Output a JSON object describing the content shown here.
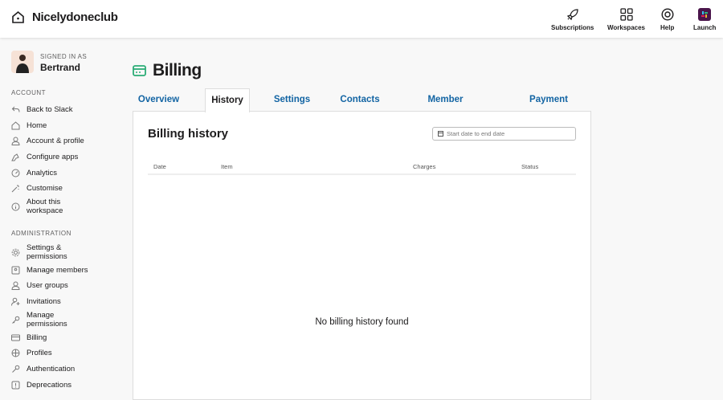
{
  "header": {
    "workspace_name": "Nicelydoneclub",
    "nav": [
      {
        "label": "Subscriptions",
        "icon": "rocket-icon"
      },
      {
        "label": "Workspaces",
        "icon": "grid-icon"
      },
      {
        "label": "Help",
        "icon": "lifebuoy-icon"
      },
      {
        "label": "Launch",
        "icon": "slack-icon"
      }
    ]
  },
  "user": {
    "signed_in_label": "SIGNED IN AS",
    "name": "Bertrand"
  },
  "sidebar": {
    "account_heading": "ACCOUNT",
    "account_items": [
      {
        "label": "Back to Slack"
      },
      {
        "label": "Home"
      },
      {
        "label": "Account & profile"
      },
      {
        "label": "Configure apps"
      },
      {
        "label": "Analytics"
      },
      {
        "label": "Customise"
      },
      {
        "label": "About this workspace"
      }
    ],
    "admin_heading": "ADMINISTRATION",
    "admin_items": [
      {
        "label": "Settings & permissions"
      },
      {
        "label": "Manage members"
      },
      {
        "label": "User groups"
      },
      {
        "label": "Invitations"
      },
      {
        "label": "Manage permissions"
      },
      {
        "label": "Billing"
      },
      {
        "label": "Profiles"
      },
      {
        "label": "Authentication"
      },
      {
        "label": "Deprecations"
      }
    ]
  },
  "page": {
    "title": "Billing",
    "accent": "#2bac76",
    "tabs": [
      {
        "label": "Overview"
      },
      {
        "label": "History"
      },
      {
        "label": "Settings"
      },
      {
        "label": "Contacts"
      },
      {
        "label": "Member changes"
      },
      {
        "label": "Payment methods"
      }
    ],
    "active_tab": "History"
  },
  "history": {
    "heading": "Billing history",
    "date_placeholder": "Start date to end date",
    "columns": [
      "Date",
      "Item",
      "Charges",
      "Status"
    ],
    "empty_text": "No billing history found"
  }
}
